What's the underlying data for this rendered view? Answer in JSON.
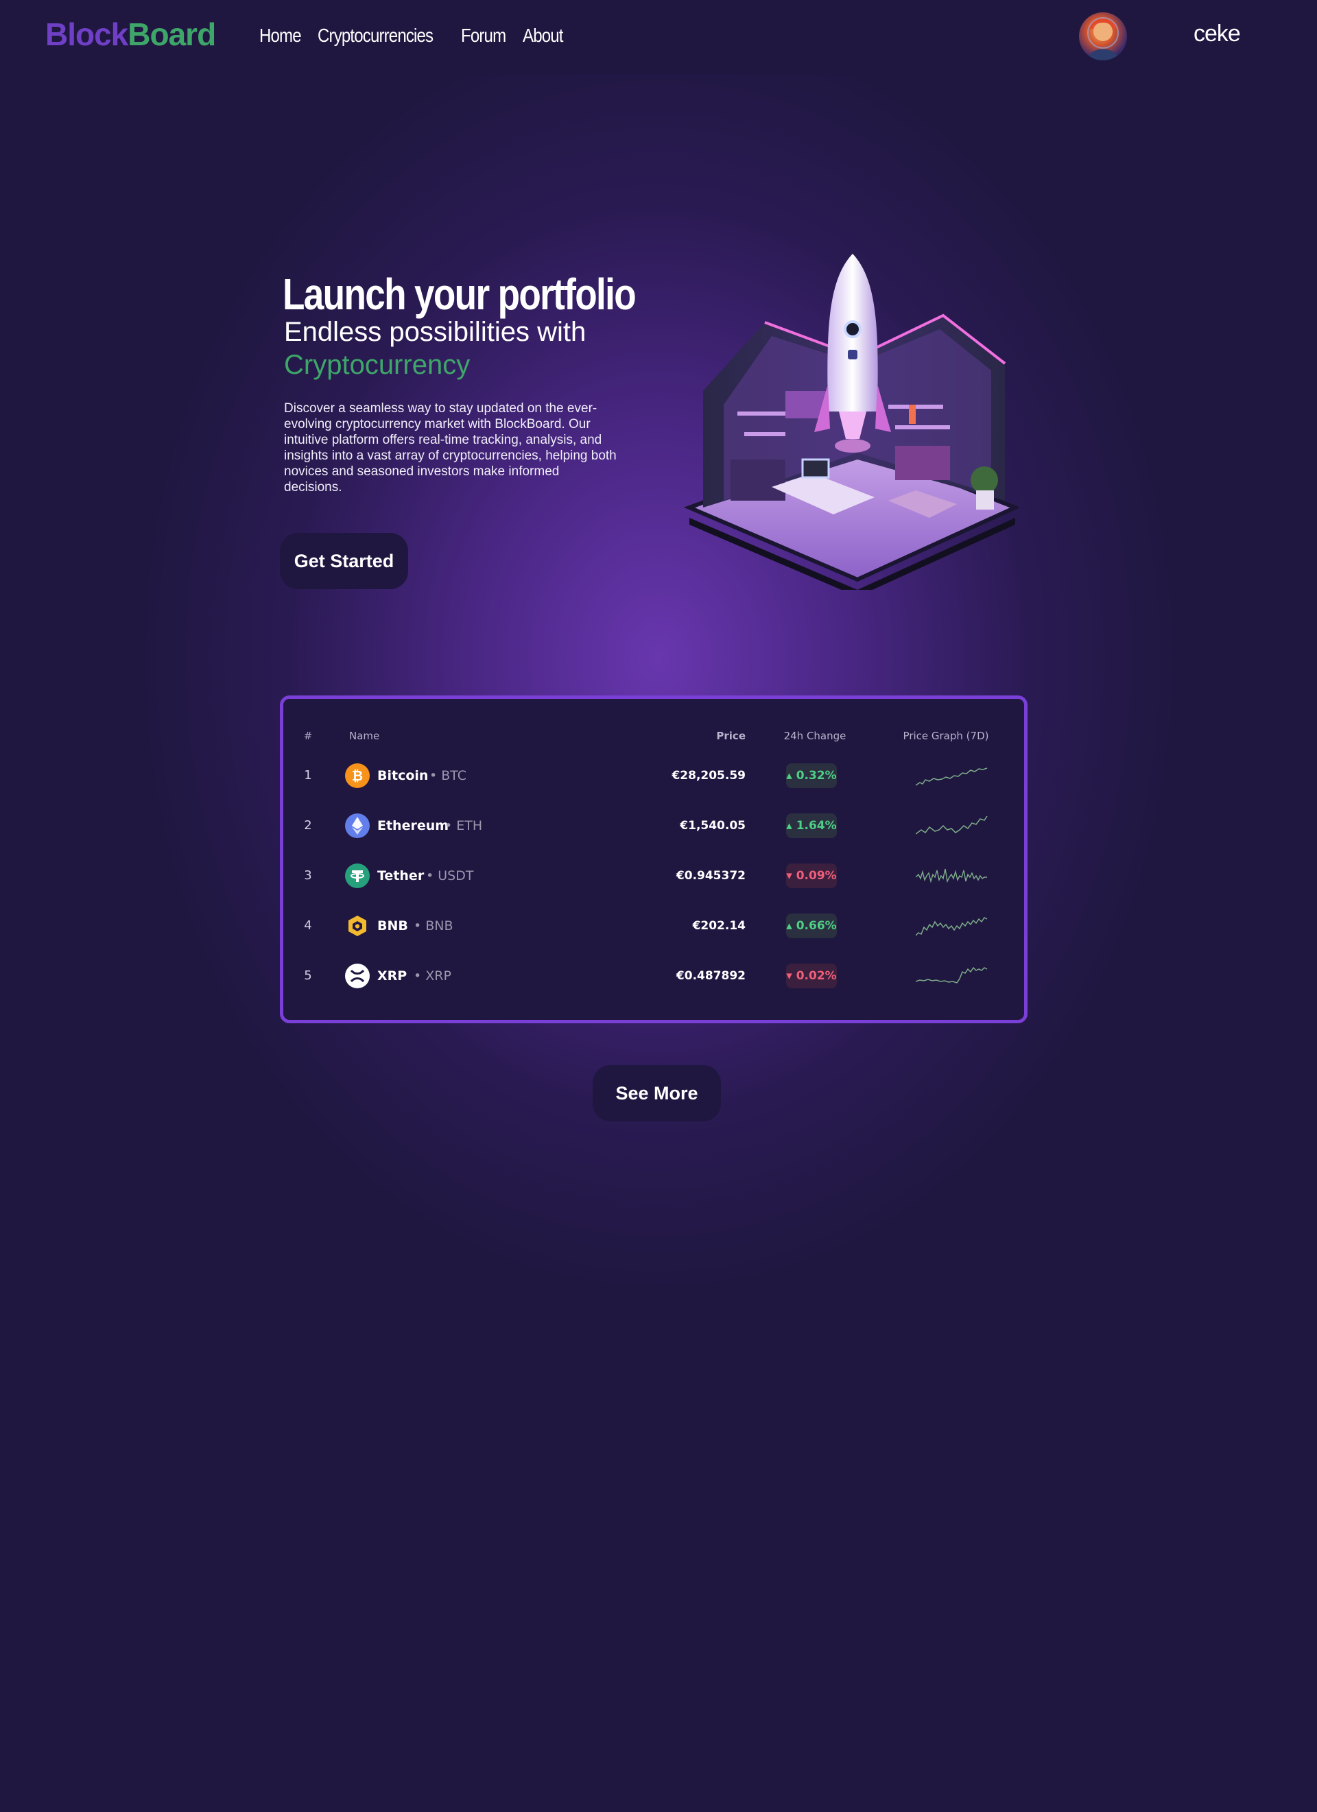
{
  "header": {
    "logo_part1": "Block",
    "logo_part2": "Board",
    "nav": [
      "Home",
      "Cryptocurrencies",
      "Forum",
      "About"
    ],
    "username": "ceke"
  },
  "hero": {
    "title": "Launch your portfolio",
    "subtitle": "Endless possibilities with",
    "accent": "Cryptocurrency",
    "description": "Discover a seamless way to stay updated on the ever-evolving cryptocurrency market with BlockBoard. Our intuitive platform offers real-time tracking, analysis, and insights into a vast array of cryptocurrencies, helping both novices and seasoned investors make informed decisions.",
    "cta": "Get Started"
  },
  "table": {
    "headers": {
      "rank": "#",
      "name": "Name",
      "price": "Price",
      "change": "24h Change",
      "graph": "Price Graph (7D)"
    },
    "rows": [
      {
        "rank": "1",
        "name": "Bitcoin",
        "symbol": "• BTC",
        "price": "€28,205.59",
        "change": "▴ 0.32%",
        "direction": "up",
        "icon": "bitcoin-icon",
        "color": "#f7931a"
      },
      {
        "rank": "2",
        "name": "Ethereum",
        "symbol": "• ETH",
        "price": "€1,540.05",
        "change": "▴ 1.64%",
        "direction": "up",
        "icon": "ethereum-icon",
        "color": "#627eea"
      },
      {
        "rank": "3",
        "name": "Tether",
        "symbol": "• USDT",
        "price": "€0.945372",
        "change": "▾ 0.09%",
        "direction": "down",
        "icon": "tether-icon",
        "color": "#26a17b"
      },
      {
        "rank": "4",
        "name": "BNB",
        "symbol": "• BNB",
        "price": "€202.14",
        "change": "▴ 0.66%",
        "direction": "up",
        "icon": "bnb-icon",
        "color": "#f3ba2f"
      },
      {
        "rank": "5",
        "name": "XRP",
        "symbol": "• XRP",
        "price": "€0.487892",
        "change": "▾ 0.02%",
        "direction": "down",
        "icon": "xrp-icon",
        "color": "#ffffff"
      }
    ],
    "more": "See More"
  },
  "colors": {
    "background": "#1f1740",
    "accent_purple": "#7a3fd6",
    "accent_green": "#3fa66a",
    "up": "#4fcf86",
    "down": "#ef5f7a"
  }
}
